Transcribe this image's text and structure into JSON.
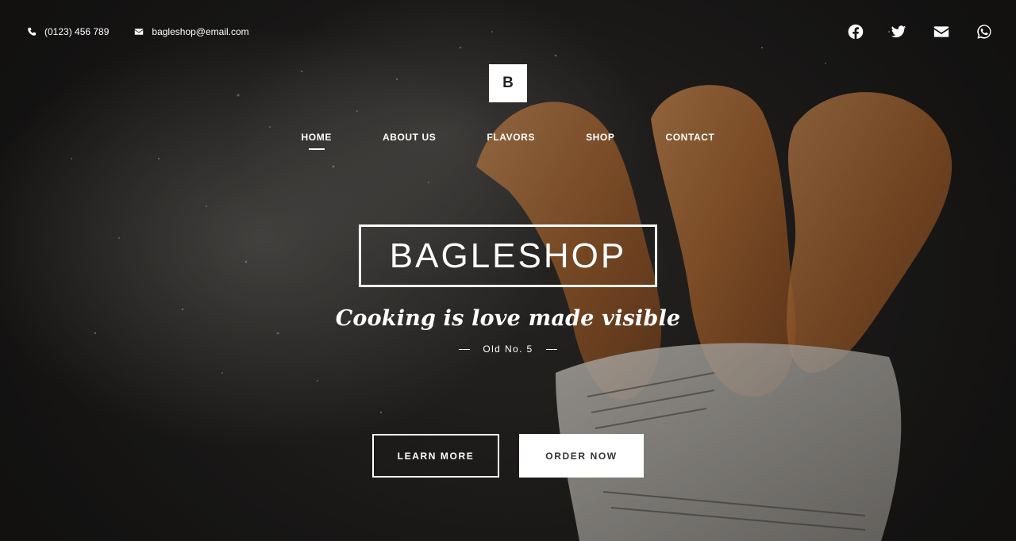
{
  "topbar": {
    "phone": "(0123) 456 789",
    "email": "bagleshop@email.com",
    "social": [
      "facebook-icon",
      "twitter-icon",
      "envelope-icon",
      "whatsapp-icon"
    ]
  },
  "logo": {
    "letter": "B"
  },
  "nav": {
    "items": [
      {
        "label": "HOME",
        "active": true
      },
      {
        "label": "ABOUT US",
        "active": false
      },
      {
        "label": "FLAVORS",
        "active": false
      },
      {
        "label": "SHOP",
        "active": false
      },
      {
        "label": "CONTACT",
        "active": false
      }
    ]
  },
  "hero": {
    "brand": "BAGLESHOP",
    "tagline": "Cooking is love made visible",
    "subline": "Old No. 5",
    "buttons": {
      "learn_more": "LEARN MORE",
      "order_now": "ORDER NOW"
    }
  },
  "colors": {
    "background": "#1a1918",
    "text": "#ffffff",
    "button_solid_text": "#333333"
  }
}
